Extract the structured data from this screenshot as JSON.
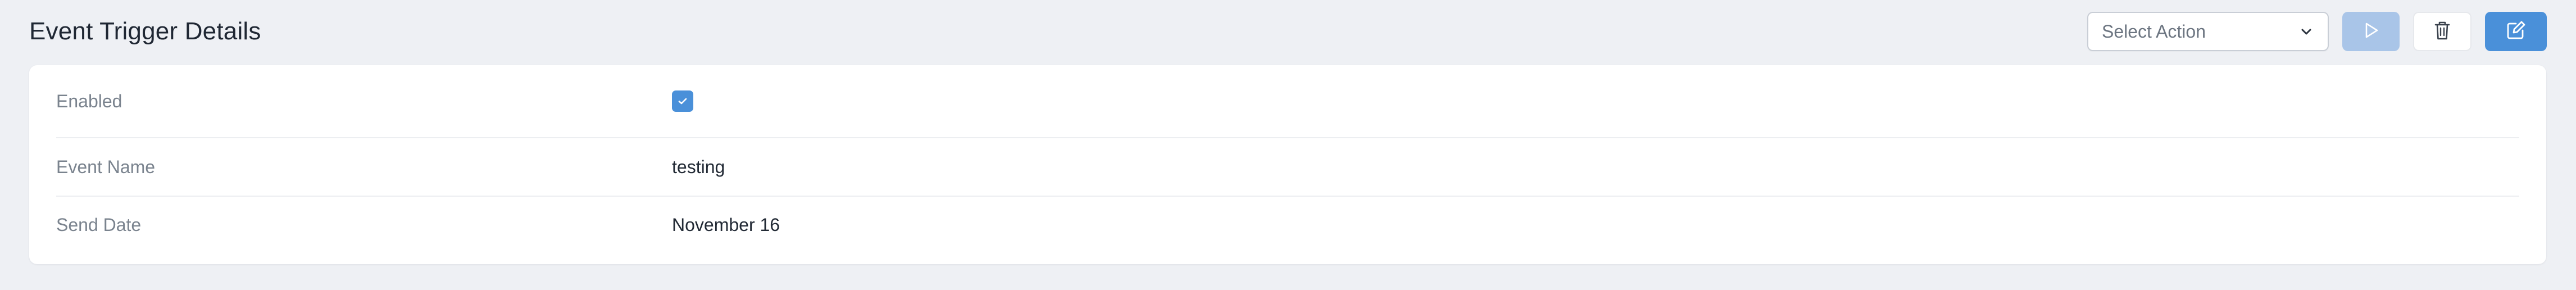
{
  "header": {
    "title": "Event Trigger Details",
    "action_select": {
      "placeholder": "Select Action"
    }
  },
  "fields": [
    {
      "label": "Enabled",
      "value": true
    },
    {
      "label": "Event Name",
      "value": "testing"
    },
    {
      "label": "Send Date",
      "value": "November 16"
    }
  ],
  "icons": {
    "select": "chevron-down-icon",
    "run": "play-icon",
    "delete": "trash-icon",
    "edit": "edit-icon",
    "checkbox": "check-icon"
  },
  "colors": {
    "background": "#eef0f4",
    "card": "#ffffff",
    "primary": "#4a90d9",
    "primary_disabled": "#a9c5e8",
    "label_text": "#7a838e",
    "value_text": "#222a35"
  }
}
